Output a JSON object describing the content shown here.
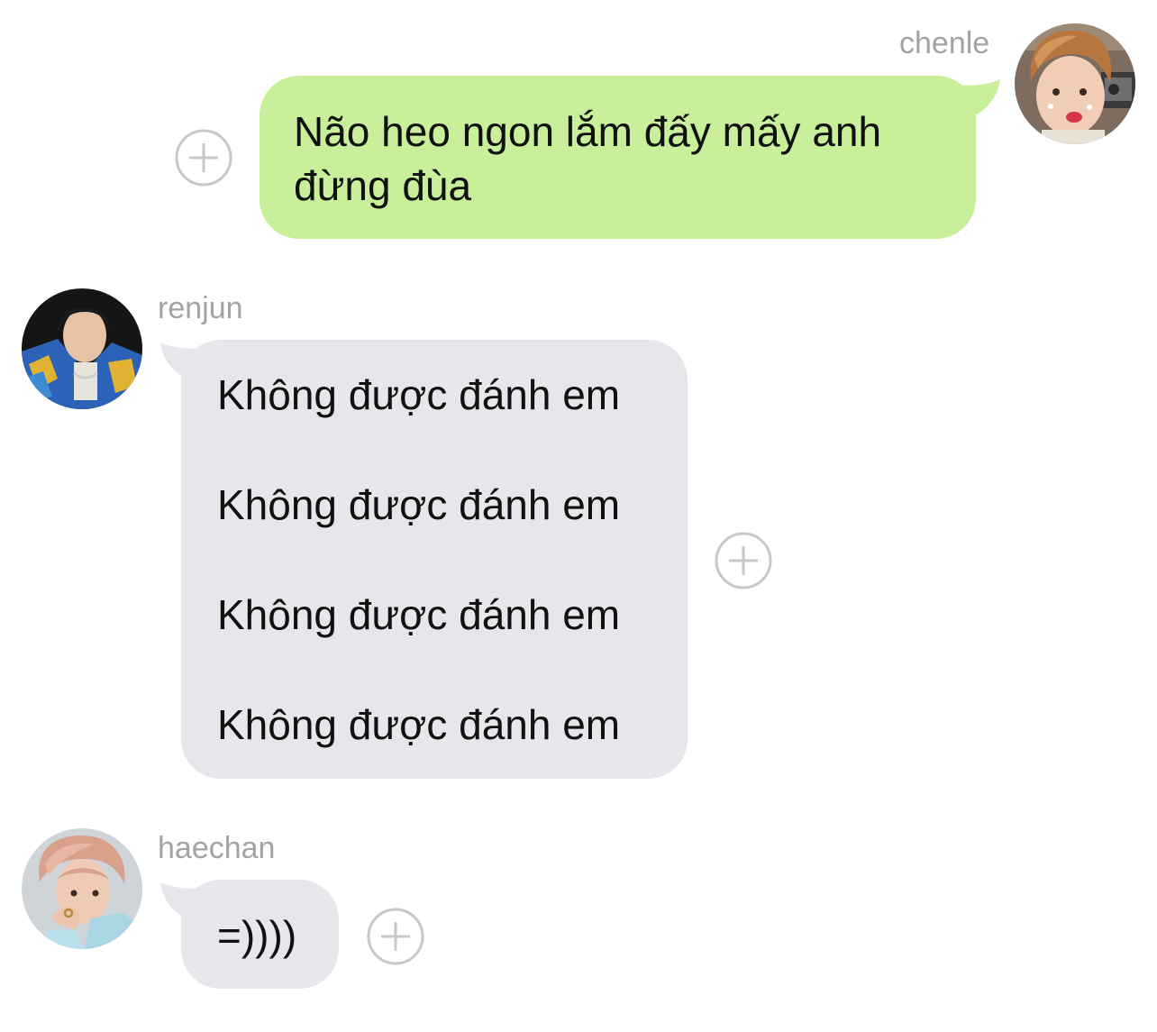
{
  "chat": {
    "messages": [
      {
        "sender": "chenle",
        "direction": "outgoing",
        "avatar": "chenle-avatar",
        "text_lines": [
          "Não heo ngon lắm đấy mấy anh",
          "đừng đùa"
        ],
        "bubble_color": "#c9ef9b",
        "add_icon": "plus-circle-icon"
      },
      {
        "sender": "renjun",
        "direction": "incoming",
        "avatar": "renjun-avatar",
        "text_lines": [
          "Không được đánh em",
          "Không được đánh em",
          "Không được đánh em",
          "Không được đánh em"
        ],
        "bubble_color": "#e5e7ea",
        "add_icon": "plus-circle-icon"
      },
      {
        "sender": "haechan",
        "direction": "incoming",
        "avatar": "haechan-avatar",
        "text_lines": [
          "=))))"
        ],
        "bubble_color": "#e5e7ea",
        "add_icon": "plus-circle-icon"
      }
    ]
  },
  "colors": {
    "outgoing_bubble": "#c9ef9b",
    "incoming_bubble": "#e5e7ea",
    "sender_name": "#a3a3a3",
    "add_icon": "#c8c8c8",
    "background": "#ffffff"
  }
}
